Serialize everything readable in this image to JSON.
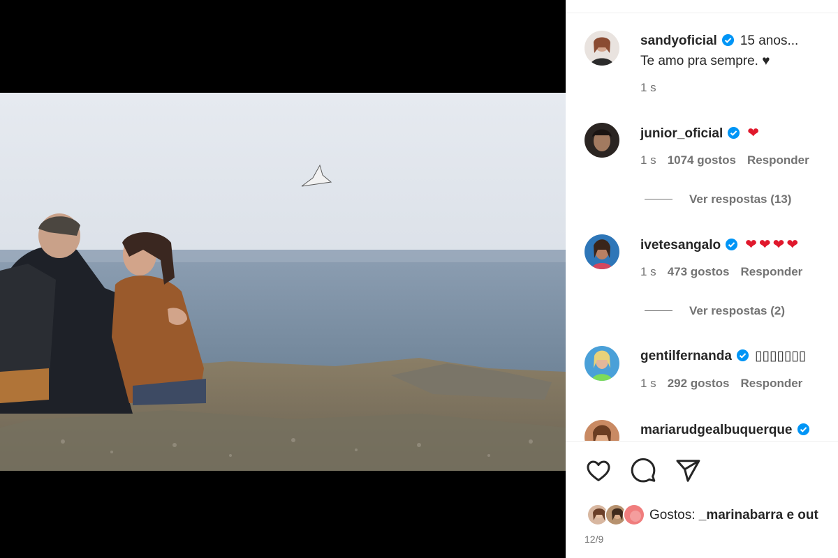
{
  "post": {
    "author": "sandyoficial",
    "caption_line1": "15 anos...",
    "caption_line2": "Te amo pra sempre. ♥",
    "time": "1 s"
  },
  "comments": [
    {
      "user": "junior_oficial",
      "text": "❤",
      "time": "1 s",
      "likes": "1074 gostos",
      "reply": "Responder",
      "view_replies": "Ver respostas (13)"
    },
    {
      "user": "ivetesangalo",
      "text": "❤❤❤❤",
      "time": "1 s",
      "likes": "473 gostos",
      "reply": "Responder",
      "view_replies": "Ver respostas (2)"
    },
    {
      "user": "gentilfernanda",
      "text": "▯▯▯▯▯▯▯",
      "time": "1 s",
      "likes": "292 gostos",
      "reply": "Responder"
    },
    {
      "user": "mariarudgealbuquerque",
      "text": ""
    }
  ],
  "actions": {
    "like_icon": "heart-icon",
    "comment_icon": "comment-bubble-icon",
    "share_icon": "paper-plane-icon"
  },
  "likes_summary": {
    "label": "Gostos:",
    "text": "_marinabarra e out"
  },
  "date": "12/9",
  "colors": {
    "verified": "#0095f6",
    "heart": "#e0182c",
    "secondary_text": "#737373"
  }
}
